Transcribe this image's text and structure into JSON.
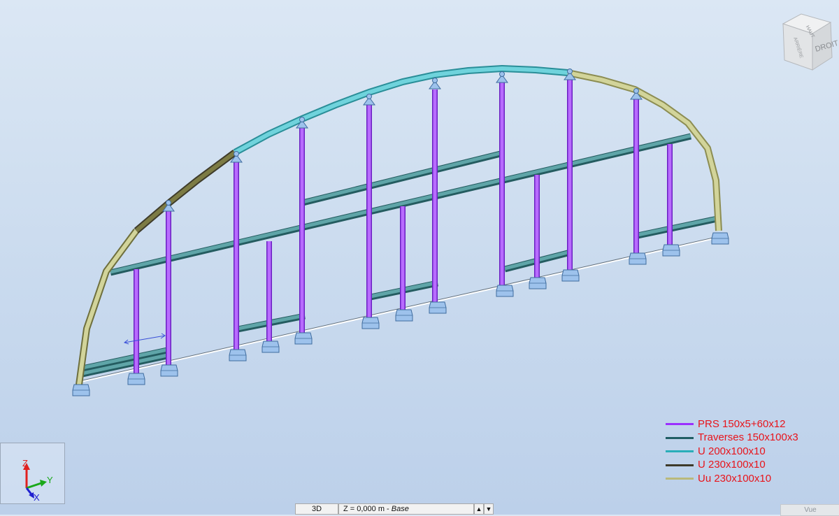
{
  "legend": {
    "items": [
      {
        "label": "PRS 150x5+60x12",
        "color": "#9b30ff"
      },
      {
        "label": "Traverses 150x100x3",
        "color": "#1f5e64"
      },
      {
        "label": "U 200x100x10",
        "color": "#2aaeb9"
      },
      {
        "label": "U 230x100x10",
        "color": "#3e3b2a"
      },
      {
        "label": "Uu 230x100x10",
        "color": "#b9b97c"
      }
    ]
  },
  "viewcube": {
    "face_front": "DROITE",
    "face_top": "HAUT",
    "face_left": "ARRIÈRE"
  },
  "axes": {
    "z": "Z",
    "y": "Y",
    "x": "X"
  },
  "statusbar": {
    "view_mode": "3D",
    "level_prefix": "Z = 0,000 m - ",
    "level_name": "Base",
    "scroll_up": "▲",
    "scroll_down": "▼"
  },
  "tab": {
    "label": "Vue"
  },
  "colors": {
    "column": "#b86bff",
    "column_edge": "#6a1fc2",
    "beam": "#5fa5a8",
    "beam_edge": "#245c60",
    "arch_cyan": "#6fd3dc",
    "arch_olive": "#7c7b44",
    "arch_khaki": "#d2d49a",
    "support": "#9dc2ec",
    "support_edge": "#3f6c9e",
    "axis_z": "#e02020",
    "axis_y": "#1aa81a",
    "axis_x": "#2020d0"
  }
}
